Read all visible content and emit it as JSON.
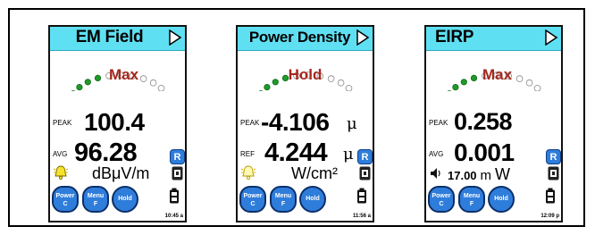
{
  "screens": [
    {
      "title": "EM Field",
      "mode": "Max",
      "row1": {
        "label": "PEAK",
        "value": "100.4",
        "unit_symbol": ""
      },
      "row2": {
        "label": "AVG",
        "value": "96.28",
        "unit_symbol": ""
      },
      "range_button": "R",
      "unit": "dBμV/m",
      "status_icon": "bell-alert-icon",
      "buttons": {
        "power": "Power",
        "power_sub": "C",
        "menu": "Menu",
        "menu_sub": "F",
        "hold": "Hold"
      },
      "time": "10:45 a",
      "dots_filled": 4,
      "dots_total": 10
    },
    {
      "title": "Power Density",
      "mode": "Hold",
      "row1": {
        "label": "PEAK",
        "value": "-4.106",
        "unit_symbol": "μ"
      },
      "row2": {
        "label": "REF",
        "value": "4.244",
        "unit_symbol": "μ"
      },
      "range_button": "R",
      "unit": "W/cm²",
      "status_icon": "bell-icon",
      "buttons": {
        "power": "Power",
        "power_sub": "C",
        "menu": "Menu",
        "menu_sub": "F",
        "hold": "Hold"
      },
      "time": "11:56 a",
      "dots_filled": 4,
      "dots_total": 10
    },
    {
      "title": "EIRP",
      "mode": "Max",
      "row1": {
        "label": "PEAK",
        "value": "0.258",
        "unit_symbol": ""
      },
      "row2": {
        "label": "AVG",
        "value": "0.001",
        "unit_symbol": ""
      },
      "range_button": "R",
      "audio_value": "17.00",
      "audio_prefix": "m",
      "unit": "W",
      "status_icon": "speaker-icon",
      "buttons": {
        "power": "Power",
        "power_sub": "C",
        "menu": "Menu",
        "menu_sub": "F",
        "hold": "Hold"
      },
      "time": "12:09 p",
      "dots_filled": 4,
      "dots_total": 10
    }
  ],
  "colors": {
    "title_bar": "#5fe0f2",
    "dot_filled": "#1f9a2a",
    "mode_text": "#a4281e",
    "button_blue": "#2f7ddb"
  }
}
